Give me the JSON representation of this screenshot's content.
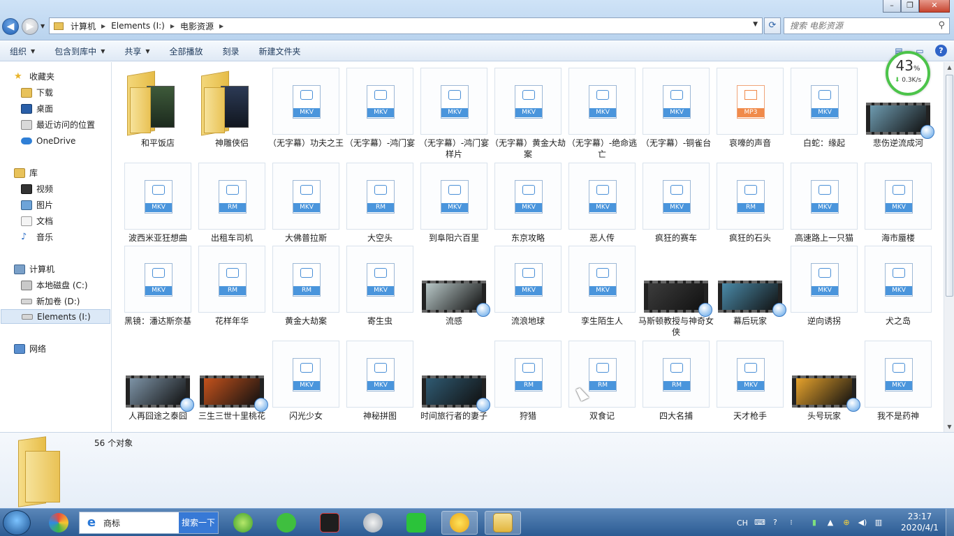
{
  "window": {
    "minimize_label": "–",
    "maximize_label": "❐",
    "close_label": "✕"
  },
  "address": {
    "crumbs": [
      "计算机",
      "Elements (I:)",
      "电影资源"
    ],
    "search_placeholder": "搜索 电影资源"
  },
  "toolbar": {
    "organize": "组织",
    "include_in_library": "包含到库中",
    "share": "共享",
    "play_all": "全部播放",
    "burn": "刻录",
    "new_folder": "新建文件夹"
  },
  "nav": {
    "favorites": "收藏夹",
    "downloads": "下载",
    "desktop": "桌面",
    "recent": "最近访问的位置",
    "onedrive": "OneDrive",
    "libraries": "库",
    "videos": "视频",
    "pictures": "图片",
    "documents": "文档",
    "music": "音乐",
    "computer": "计算机",
    "drive_c": "本地磁盘 (C:)",
    "drive_d": "新加卷 (D:)",
    "drive_i": "Elements (I:)",
    "network": "网络"
  },
  "files": [
    {
      "name": "和平饭店",
      "kind": "folder",
      "style": "green"
    },
    {
      "name": "神雕侠侣",
      "kind": "folder",
      "style": "dark"
    },
    {
      "name": "（无字幕）功夫之王",
      "kind": "doc",
      "ext": "MKV"
    },
    {
      "name": "（无字幕）-鸿门宴",
      "kind": "doc",
      "ext": "MKV"
    },
    {
      "name": "（无字幕）-鸿门宴样片",
      "kind": "doc",
      "ext": "MKV"
    },
    {
      "name": "（无字幕）黄金大劫案",
      "kind": "doc",
      "ext": "MKV"
    },
    {
      "name": "（无字幕）-绝命逃亡",
      "kind": "doc",
      "ext": "MKV"
    },
    {
      "name": "（无字幕）-铜雀台",
      "kind": "doc",
      "ext": "MKV"
    },
    {
      "name": "哀嚎的声音",
      "kind": "doc",
      "ext": "MP3"
    },
    {
      "name": "白蛇：缘起",
      "kind": "doc",
      "ext": "MKV"
    },
    {
      "name": "悲伤逆流成河",
      "kind": "video",
      "color": "#6e9bb0"
    },
    {
      "name": "波西米亚狂想曲",
      "kind": "doc",
      "ext": "MKV"
    },
    {
      "name": "出租车司机",
      "kind": "doc",
      "ext": "RM"
    },
    {
      "name": "大佛普拉斯",
      "kind": "doc",
      "ext": "MKV"
    },
    {
      "name": "大空头",
      "kind": "doc",
      "ext": "RM"
    },
    {
      "name": "到阜阳六百里",
      "kind": "doc",
      "ext": "MKV"
    },
    {
      "name": "东京攻略",
      "kind": "doc",
      "ext": "MKV"
    },
    {
      "name": "恶人传",
      "kind": "doc",
      "ext": "MKV"
    },
    {
      "name": "疯狂的赛车",
      "kind": "doc",
      "ext": "MKV"
    },
    {
      "name": "疯狂的石头",
      "kind": "doc",
      "ext": "RM"
    },
    {
      "name": "高速路上一只猫",
      "kind": "doc",
      "ext": "MKV"
    },
    {
      "name": "海市蜃楼",
      "kind": "doc",
      "ext": "MKV"
    },
    {
      "name": "黑镜：潘达斯奈基",
      "kind": "doc",
      "ext": "MKV"
    },
    {
      "name": "花样年华",
      "kind": "doc",
      "ext": "RM"
    },
    {
      "name": "黄金大劫案",
      "kind": "doc",
      "ext": "RM"
    },
    {
      "name": "寄生虫",
      "kind": "doc",
      "ext": "MKV"
    },
    {
      "name": "流感",
      "kind": "video",
      "color": "#b8c7c7"
    },
    {
      "name": "流浪地球",
      "kind": "doc",
      "ext": "MKV"
    },
    {
      "name": "孪生陌生人",
      "kind": "doc",
      "ext": "MKV"
    },
    {
      "name": "马斯顿教授与神奇女侠",
      "kind": "video",
      "color": "#3c3c3c"
    },
    {
      "name": "幕后玩家",
      "kind": "video",
      "color": "#4a8aa8"
    },
    {
      "name": "逆向诱拐",
      "kind": "doc",
      "ext": "MKV"
    },
    {
      "name": "犬之岛",
      "kind": "doc",
      "ext": "MKV"
    },
    {
      "name": "人再囧途之泰囧",
      "kind": "video",
      "color": "#7d93a6"
    },
    {
      "name": "三生三世十里桃花",
      "kind": "video",
      "color": "#c4521c"
    },
    {
      "name": "闪光少女",
      "kind": "doc",
      "ext": "MKV"
    },
    {
      "name": "神秘拼图",
      "kind": "doc",
      "ext": "MKV"
    },
    {
      "name": "时间旅行者的妻子",
      "kind": "video",
      "color": "#2f5a72"
    },
    {
      "name": "狩猎",
      "kind": "doc",
      "ext": "RM"
    },
    {
      "name": "双食记",
      "kind": "doc",
      "ext": "RM"
    },
    {
      "name": "四大名捕",
      "kind": "doc",
      "ext": "RM"
    },
    {
      "name": "天才枪手",
      "kind": "doc",
      "ext": "MKV"
    },
    {
      "name": "头号玩家",
      "kind": "video",
      "color": "#e6a22c"
    },
    {
      "name": "我不是药神",
      "kind": "doc",
      "ext": "MKV"
    }
  ],
  "details": {
    "count": "56 个对象"
  },
  "speed_widget": {
    "percent": "43",
    "percent_sign": "%",
    "rate": "0.3K/s",
    "ring_color": "#4cc44a"
  },
  "taskbar": {
    "search_text": "商标",
    "search_button": "搜索一下",
    "tray_lang": "CH",
    "time": "23:17",
    "date": "2020/4/1"
  }
}
